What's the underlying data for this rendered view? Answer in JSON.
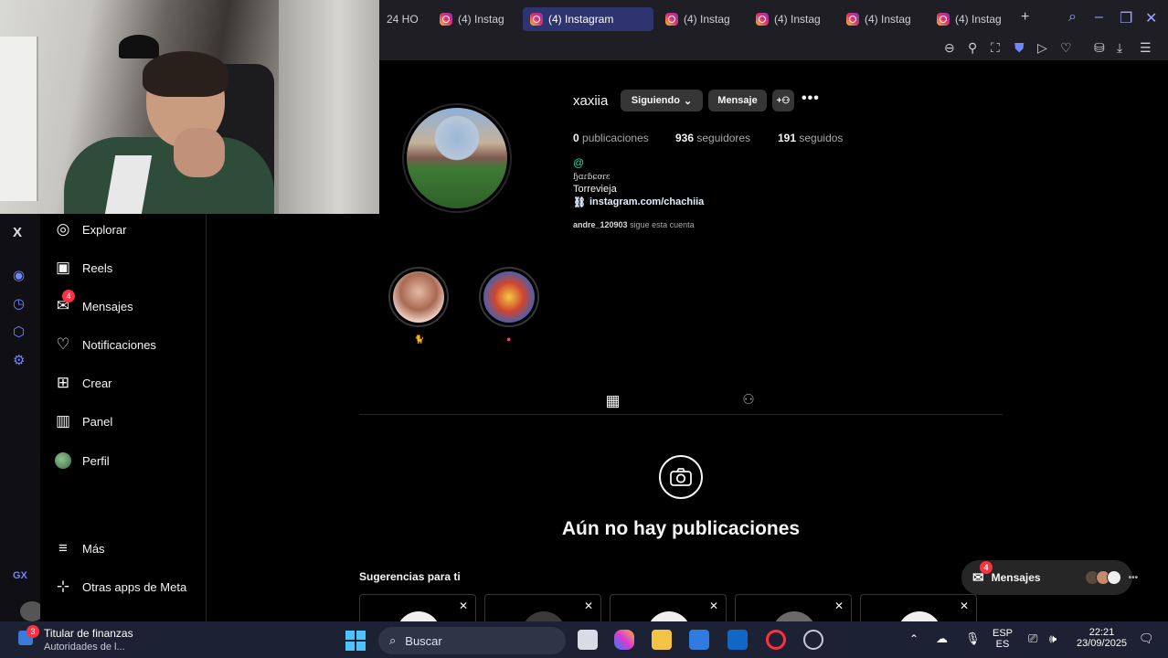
{
  "browser": {
    "tabs": [
      {
        "label": "24 HO",
        "active": false,
        "ig": false
      },
      {
        "label": "(4) Instag",
        "active": false,
        "ig": true
      },
      {
        "label": "(4) Instagram",
        "active": true,
        "ig": true
      },
      {
        "label": "(4) Instag",
        "active": false,
        "ig": true
      },
      {
        "label": "(4) Instag",
        "active": false,
        "ig": true
      },
      {
        "label": "(4) Instag",
        "active": false,
        "ig": true
      },
      {
        "label": "(4) Instag",
        "active": false,
        "ig": true
      }
    ],
    "new_tab_label": "+",
    "accent": "#2d3470"
  },
  "nav": {
    "items": [
      {
        "label": "Explorar",
        "icon": "compass-icon",
        "glyph": "◎"
      },
      {
        "label": "Reels",
        "icon": "reels-icon",
        "glyph": "▣"
      },
      {
        "label": "Mensajes",
        "icon": "messenger-icon",
        "glyph": "✉",
        "badge": "4"
      },
      {
        "label": "Notificaciones",
        "icon": "heart-icon",
        "glyph": "♡"
      },
      {
        "label": "Crear",
        "icon": "plus-square-icon",
        "glyph": "⊞"
      },
      {
        "label": "Panel",
        "icon": "chart-icon",
        "glyph": "▥"
      },
      {
        "label": "Perfil",
        "icon": "avatar",
        "glyph": ""
      }
    ],
    "more_label": "Más",
    "meta_label": "Otras apps de Meta"
  },
  "profile": {
    "username": "xaxiia",
    "following_button": "Siguiendo",
    "message_button": "Mensaje",
    "posts_count": "0",
    "posts_label": "publicaciones",
    "followers_count": "936",
    "followers_label": "seguidores",
    "following_count": "191",
    "following_label": "seguidos",
    "bio_name": "ɧɑɾɓɕơɾɛ",
    "bio_city": "Torrevieja",
    "bio_link": "instagram.com/chachiia",
    "followed_by_user": "andre_120903",
    "followed_by_text": "sigue esta cuenta"
  },
  "empty_state": {
    "title": "Aún no hay publicaciones"
  },
  "suggestions": {
    "title": "Sugerencias para ti",
    "close_glyph": "✕"
  },
  "messages_pill": {
    "label": "Mensajes",
    "badge": "4"
  },
  "taskbar": {
    "widget_badge": "3",
    "widget_title": "Titular de finanzas",
    "widget_subtitle": "Autoridades de l...",
    "search_placeholder": "Buscar",
    "lang_top": "ESP",
    "lang_bottom": "ES",
    "time": "22:21",
    "date": "23/09/2025"
  }
}
